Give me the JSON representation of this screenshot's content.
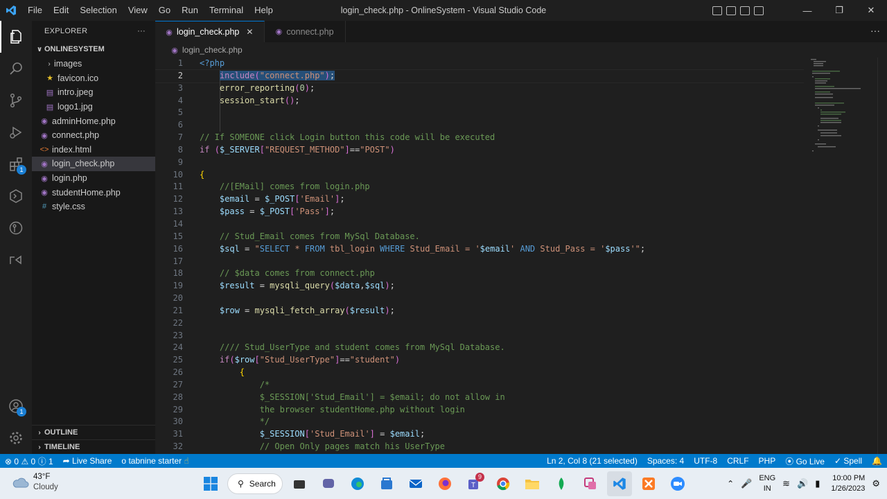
{
  "titlebar": {
    "menus": [
      "File",
      "Edit",
      "Selection",
      "View",
      "Go",
      "Run",
      "Terminal",
      "Help"
    ],
    "title": "login_check.php - OnlineSystem - Visual Studio Code"
  },
  "activity": {
    "extensions_badge": "1",
    "accounts_badge": "1"
  },
  "sidebar": {
    "header": "EXPLORER",
    "project": "ONLINESYSTEM",
    "items": [
      {
        "label": "images",
        "type": "folder"
      },
      {
        "label": "favicon.ico",
        "type": "ico"
      },
      {
        "label": "intro.jpeg",
        "type": "img"
      },
      {
        "label": "logo1.jpg",
        "type": "img"
      },
      {
        "label": "adminHome.php",
        "type": "php"
      },
      {
        "label": "connect.php",
        "type": "php"
      },
      {
        "label": "index.html",
        "type": "html"
      },
      {
        "label": "login_check.php",
        "type": "php"
      },
      {
        "label": "login.php",
        "type": "php"
      },
      {
        "label": "studentHome.php",
        "type": "php"
      },
      {
        "label": "style.css",
        "type": "css"
      }
    ],
    "outline": "OUTLINE",
    "timeline": "TIMELINE"
  },
  "tabs": [
    {
      "label": "login_check.php",
      "active": true
    },
    {
      "label": "connect.php",
      "active": false
    }
  ],
  "breadcrumb": "login_check.php",
  "code": {
    "current_line": 2,
    "lines": [
      "<?php",
      "    include(\"connect.php\");",
      "    error_reporting(0);",
      "    session_start();",
      "",
      "",
      "// If SOMEONE click Login button this code will be executed",
      "if ($_SERVER[\"REQUEST_METHOD\"]==\"POST\")",
      "",
      "{",
      "    //[EMail] comes from login.php",
      "    $email = $_POST['Email'];",
      "    $pass = $_POST['Pass'];",
      "",
      "    // Stud_Email comes from MySql Database.",
      "    $sql = \"SELECT * FROM tbl_login WHERE Stud_Email = '$email' AND Stud_Pass = '$pass'\";",
      "",
      "    // $data comes from connect.php",
      "    $result = mysqli_query($data,$sql);",
      "",
      "    $row = mysqli_fetch_array($result);",
      "",
      "",
      "    //// Stud_UserType and student comes from MySql Database.",
      "    if($row[\"Stud_UserType\"]==\"student\")",
      "        {",
      "            /*",
      "            $_SESSION['Stud_Email'] = $email; do not allow in",
      "            the browser studentHome.php without login",
      "            */",
      "            $_SESSION['Stud_Email'] = $email;",
      "            // Open Only pages match his UserType"
    ]
  },
  "statusbar": {
    "errors": "0",
    "warnings": "0",
    "info": "1",
    "live_share": "Live Share",
    "tabnine": "tabnine starter",
    "position": "Ln 2, Col 8 (21 selected)",
    "spaces": "Spaces: 4",
    "encoding": "UTF-8",
    "eol": "CRLF",
    "language": "PHP",
    "go_live": "Go Live",
    "spell": "Spell"
  },
  "taskbar": {
    "temp": "43°F",
    "weather": "Cloudy",
    "search": "Search",
    "teams_badge": "9",
    "lang_top": "ENG",
    "lang_bottom": "IN",
    "time": "10:00 PM",
    "date": "1/26/2023"
  },
  "colors": {
    "accent": "#007acc",
    "editor_bg": "#1f1f1f",
    "sidebar_bg": "#181818",
    "selection": "#264f78"
  }
}
